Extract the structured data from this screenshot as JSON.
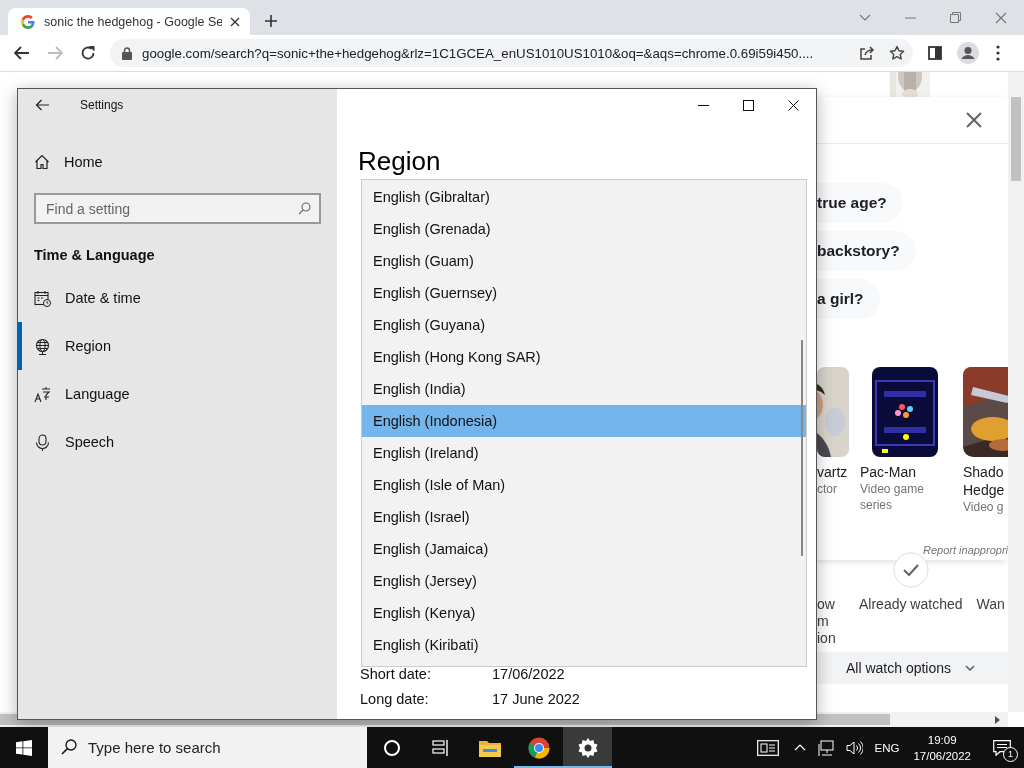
{
  "browser": {
    "tabs": [
      {
        "title": "sonic the hedgehog - Google Se",
        "selected": true
      }
    ],
    "address": "google.com/search?q=sonic+the+hedgehog&rlz=1C1GCEA_enUS1010US1010&oq=&aqs=chrome.0.69i59i450....",
    "forward_disabled": true
  },
  "page": {
    "questions": [
      "true age?",
      "backstory?",
      "a girl?"
    ],
    "cards": [
      {
        "kind": "person",
        "title_lines": [
          "vartz"
        ],
        "subtitle": "ctor"
      },
      {
        "kind": "maze",
        "title_lines": [
          "Pac-Man"
        ],
        "subtitle": "Video game series"
      },
      {
        "kind": "action",
        "title_lines": [
          "Shado",
          "Hedge"
        ],
        "subtitle": "Video g"
      }
    ],
    "report": "Report inappropri",
    "watch_actions": [
      {
        "kind": "partial",
        "label_lines": [
          "ow",
          "m",
          "ion"
        ]
      },
      {
        "kind": "check",
        "label_lines": [
          "Already watched"
        ]
      },
      {
        "kind": "partial",
        "label_lines": [
          "Wan"
        ]
      }
    ],
    "watch_options": "All watch options"
  },
  "settings": {
    "title": "Settings",
    "home": "Home",
    "search": {
      "placeholder": "Find a setting"
    },
    "section": "Time & Language",
    "nav": [
      {
        "label": "Date & time",
        "kind": "calendar",
        "selected": false
      },
      {
        "label": "Region",
        "kind": "globe",
        "selected": true
      },
      {
        "label": "Language",
        "kind": "language",
        "selected": false
      },
      {
        "label": "Speech",
        "kind": "microphone",
        "selected": false
      }
    ],
    "heading": "Region",
    "region_list": [
      {
        "label": "English (Gibraltar)",
        "selected": false
      },
      {
        "label": "English (Grenada)",
        "selected": false
      },
      {
        "label": "English (Guam)",
        "selected": false
      },
      {
        "label": "English (Guernsey)",
        "selected": false
      },
      {
        "label": "English (Guyana)",
        "selected": false
      },
      {
        "label": "English (Hong Kong SAR)",
        "selected": false
      },
      {
        "label": "English (India)",
        "selected": false
      },
      {
        "label": "English (Indonesia)",
        "selected": true
      },
      {
        "label": "English (Ireland)",
        "selected": false
      },
      {
        "label": "English (Isle of Man)",
        "selected": false
      },
      {
        "label": "English (Israel)",
        "selected": false
      },
      {
        "label": "English (Jamaica)",
        "selected": false
      },
      {
        "label": "English (Jersey)",
        "selected": false
      },
      {
        "label": "English (Kenya)",
        "selected": false
      },
      {
        "label": "English (Kiribati)",
        "selected": false
      }
    ],
    "formats": [
      {
        "label": "Short date:",
        "value": "17/06/2022"
      },
      {
        "label": "Long date:",
        "value": "17 June 2022"
      }
    ]
  },
  "taskbar": {
    "search": {
      "placeholder": "Type here to search"
    },
    "apps": [
      {
        "kind": "cortana",
        "active": false,
        "running": false
      },
      {
        "kind": "taskview",
        "active": false,
        "running": false
      },
      {
        "kind": "explorer",
        "active": false,
        "running": false
      },
      {
        "kind": "chrome",
        "active": false,
        "running": true
      },
      {
        "kind": "settings",
        "active": true,
        "running": true
      }
    ],
    "language": "ENG",
    "time": "19:09",
    "date": "17/06/2022",
    "notifications": "1"
  }
}
